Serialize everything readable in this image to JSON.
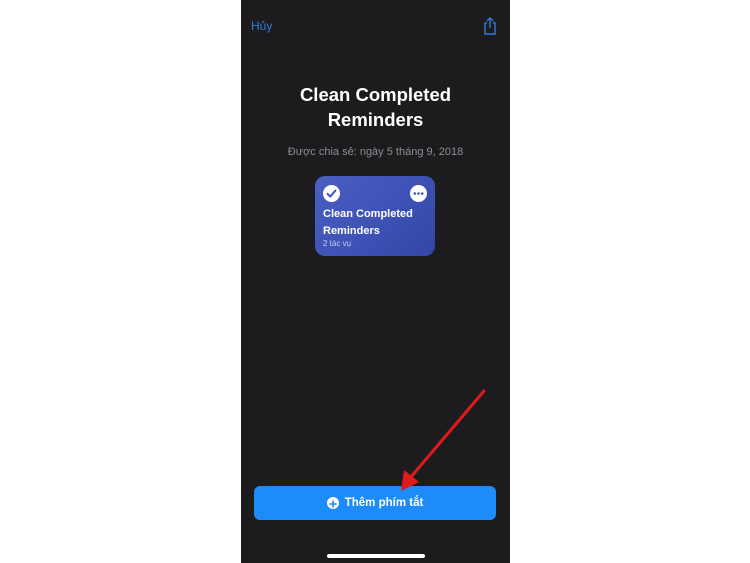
{
  "nav": {
    "cancel_label": "Hủy"
  },
  "shortcut": {
    "title": "Clean Completed Reminders",
    "shared_date": "Được chia sẻ: ngày 5 tháng 9, 2018"
  },
  "card": {
    "title": "Clean Completed Reminders",
    "subtitle": "2 tác vụ"
  },
  "actions": {
    "add_label": "Thêm phím tắt"
  },
  "colors": {
    "accent": "#1e8cf8",
    "card": "#3f52b8",
    "background": "#1c1c1e",
    "annotation_arrow": "#e0191b"
  }
}
